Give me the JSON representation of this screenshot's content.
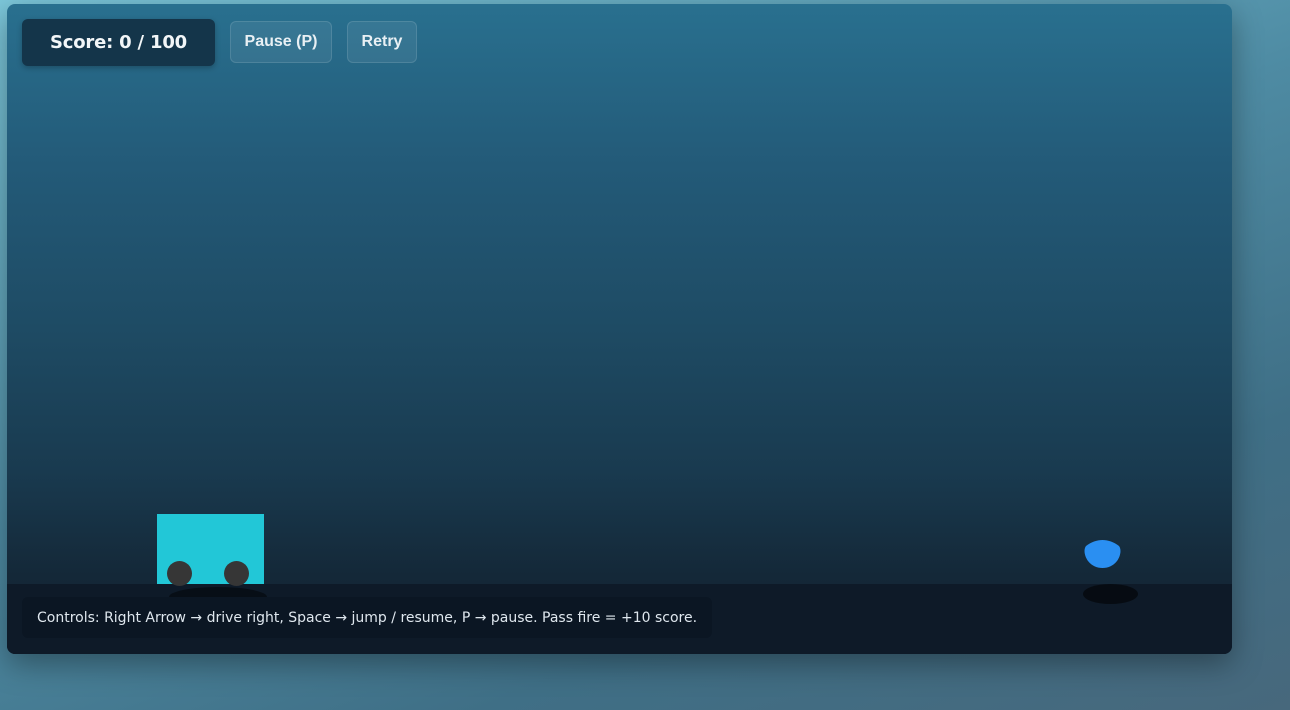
{
  "hud": {
    "score_text": "Score: 0 / 100",
    "pause_label": "Pause (P)",
    "retry_label": "Retry"
  },
  "footer": {
    "controls_text": "Controls: Right Arrow → drive right, Space → jump / resume, P → pause. Pass fire = +10 score."
  },
  "colors": {
    "car_body": "#22c7d7",
    "car_wheels": "#363636",
    "fire": "#2a8ff2",
    "sky_top": "#29708f",
    "sky_bottom": "#101e2c",
    "ground": "#0e1a28"
  },
  "entities": {
    "player": "car",
    "obstacle": "fire"
  }
}
